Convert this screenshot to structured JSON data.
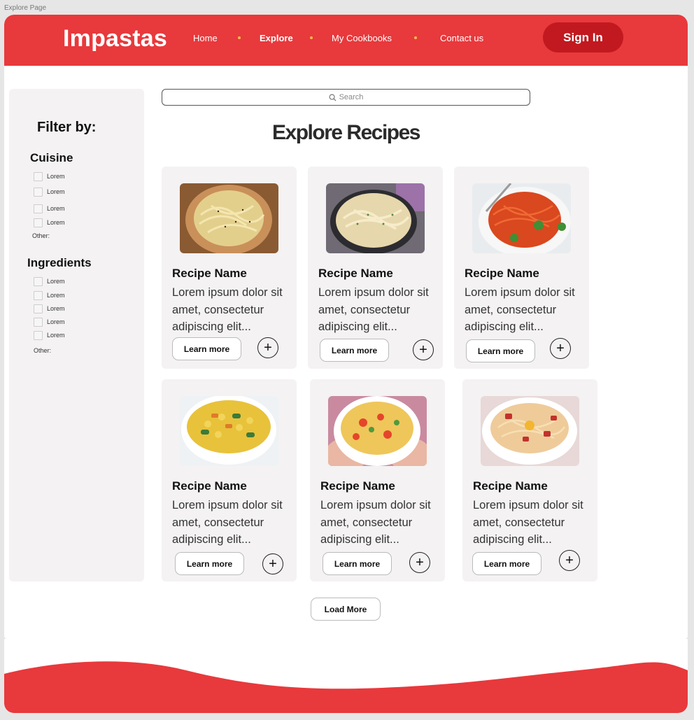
{
  "frame_label": "Explore Page",
  "header": {
    "logo": "Impastas",
    "nav": [
      "Home",
      "Explore",
      "My Cookbooks",
      "Contact us"
    ],
    "active_nav": "Explore",
    "signin_label": "Sign In"
  },
  "sidebar": {
    "title": "Filter by:",
    "cuisine": {
      "title": "Cuisine",
      "options": [
        "Lorem",
        "Lorem",
        "Lorem",
        "Lorem"
      ],
      "other_label": "Other:"
    },
    "ingredients": {
      "title": "Ingredients",
      "options": [
        "Lorem",
        "Lorem",
        "Lorem",
        "Lorem",
        "Lorem"
      ],
      "other_label": "Other:"
    }
  },
  "search": {
    "placeholder": "Search"
  },
  "main": {
    "title": "Explore Recipes",
    "recipes": [
      {
        "name": "Recipe Name",
        "desc": "Lorem ipsum dolor sit amet, consectetur adipiscing elit...",
        "learn_label": "Learn more",
        "add_label": "+"
      },
      {
        "name": "Recipe Name",
        "desc": "Lorem ipsum dolor sit amet, consectetur adipiscing elit...",
        "learn_label": "Learn more",
        "add_label": "+"
      },
      {
        "name": "Recipe Name",
        "desc": "Lorem ipsum dolor sit amet, consectetur adipiscing elit...",
        "learn_label": "Learn more",
        "add_label": "+"
      },
      {
        "name": "Recipe Name",
        "desc": "Lorem ipsum dolor sit amet, consectetur adipiscing elit...",
        "learn_label": "Learn more",
        "add_label": "+"
      },
      {
        "name": "Recipe Name",
        "desc": "Lorem ipsum dolor sit amet, consectetur adipiscing elit...",
        "learn_label": "Learn more",
        "add_label": "+"
      },
      {
        "name": "Recipe Name",
        "desc": "Lorem ipsum dolor sit amet, consectetur adipiscing elit...",
        "learn_label": "Learn more",
        "add_label": "+"
      }
    ],
    "load_more_label": "Load More"
  },
  "colors": {
    "brand": "#e8393c",
    "brand_dark": "#c1191f",
    "nav_dot": "#f3bf45",
    "card_bg": "#f4f2f2"
  },
  "icons": {
    "search": "search-icon",
    "add": "plus-circle-icon"
  }
}
